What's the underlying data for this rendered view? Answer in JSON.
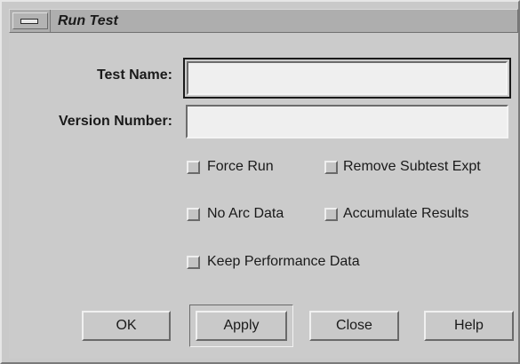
{
  "window": {
    "title": "Run Test"
  },
  "form": {
    "test_name_label": "Test Name:",
    "test_name_value": "",
    "version_number_label": "Version Number:",
    "version_number_value": ""
  },
  "options": [
    {
      "label": "Force Run",
      "checked": false
    },
    {
      "label": "Remove Subtest Expt",
      "checked": false
    },
    {
      "label": "No Arc Data",
      "checked": false
    },
    {
      "label": "Accumulate Results",
      "checked": false
    },
    {
      "label": "Keep Performance Data",
      "checked": false
    }
  ],
  "buttons": {
    "ok": "OK",
    "apply": "Apply",
    "close": "Close",
    "help": "Help"
  },
  "icons": {
    "window_menu": "window-menu-icon"
  },
  "colors": {
    "background": "#c9c9c9",
    "titlebar": "#aeaeae",
    "field": "#efefef"
  }
}
